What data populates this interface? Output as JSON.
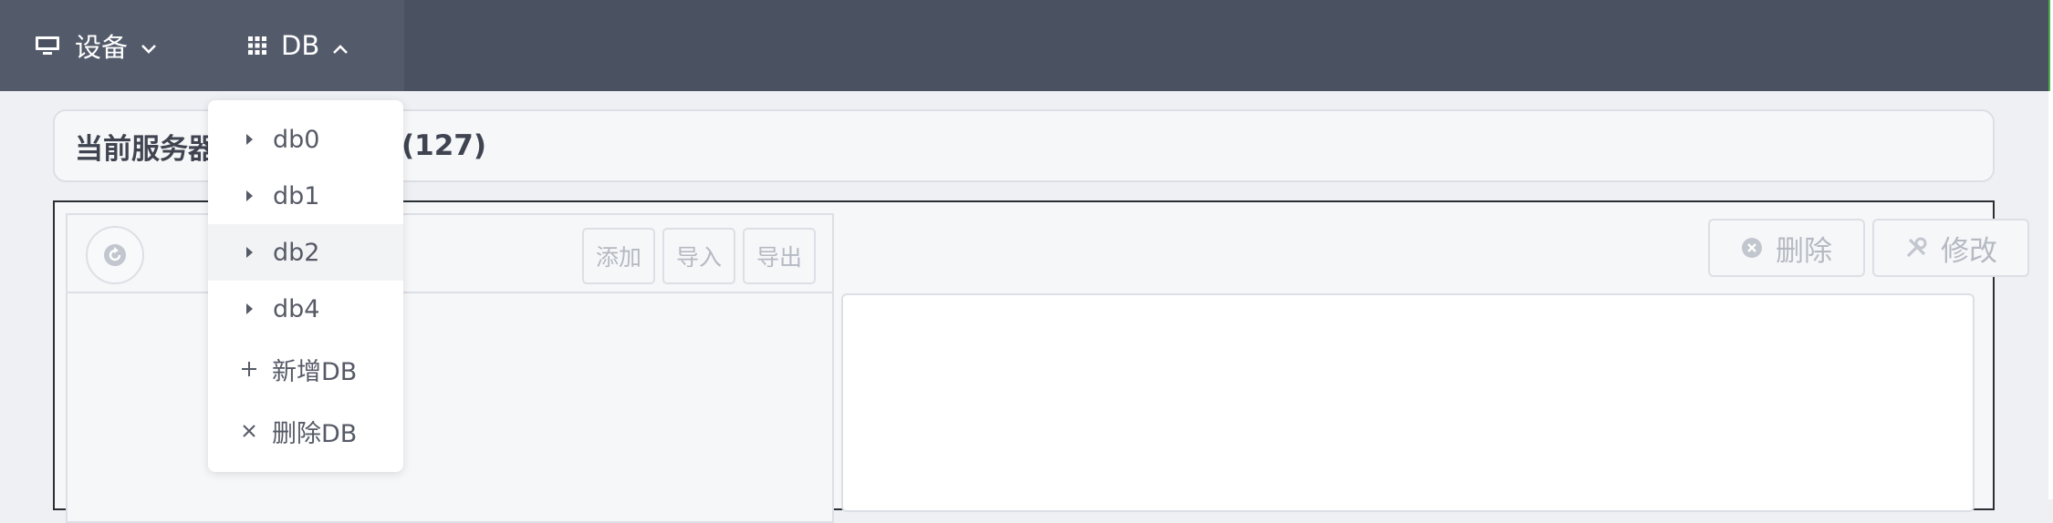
{
  "nav": {
    "device_label": "设备",
    "db_label": "DB"
  },
  "title": {
    "prefix": "当前服务器",
    "suffix": "(127)"
  },
  "toolbar": {
    "add_label": "添加",
    "import_label": "导入",
    "export_label": "导出",
    "delete_label": "删除",
    "modify_label": "修改"
  },
  "dropdown": {
    "items": [
      {
        "label": "db0"
      },
      {
        "label": "db1"
      },
      {
        "label": "db2"
      },
      {
        "label": "db4"
      }
    ],
    "add_db_label": "新增DB",
    "delete_db_label": "删除DB"
  }
}
